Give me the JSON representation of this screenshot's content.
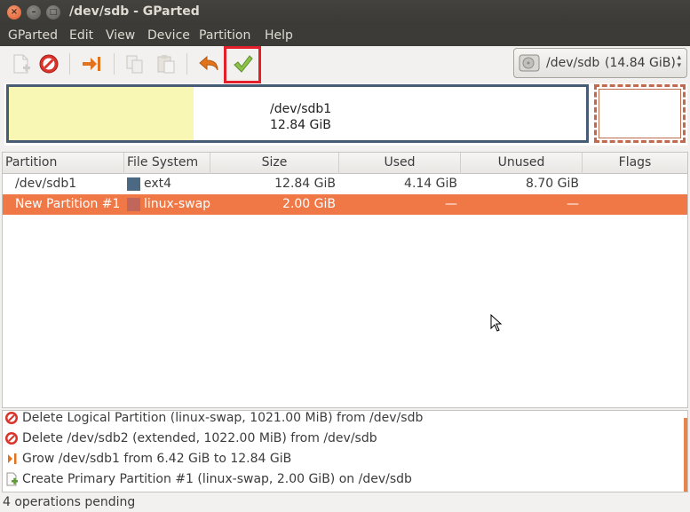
{
  "window": {
    "title": "/dev/sdb - GParted"
  },
  "menubar": {
    "items": [
      "GParted",
      "Edit",
      "View",
      "Device",
      "Partition",
      "Help"
    ]
  },
  "toolbar": {
    "buttons": [
      {
        "icon": "new-partition-icon",
        "enabled": false
      },
      {
        "icon": "delete-icon",
        "enabled": true
      },
      {
        "icon": "resize-move-icon",
        "enabled": true
      },
      {
        "icon": "copy-icon",
        "enabled": false
      },
      {
        "icon": "paste-icon",
        "enabled": false
      },
      {
        "icon": "undo-icon",
        "enabled": true
      },
      {
        "icon": "apply-icon",
        "enabled": true
      }
    ]
  },
  "device_selector": {
    "device": "/dev/sdb",
    "size": "(14.84 GiB)"
  },
  "disk_map": {
    "partition_name": "/dev/sdb1",
    "partition_size": "12.84 GiB",
    "used_fraction": 0.32
  },
  "table": {
    "headers": [
      "Partition",
      "File System",
      "Size",
      "Used",
      "Unused",
      "Flags"
    ],
    "rows": [
      {
        "partition": "/dev/sdb1",
        "fs": "ext4",
        "fs_color": "#4b6983",
        "size": "12.84 GiB",
        "used": "4.14 GiB",
        "unused": "8.70 GiB",
        "flags": "",
        "selected": false
      },
      {
        "partition": "New Partition #1",
        "fs": "linux-swap",
        "fs_color": "#c1665a",
        "size": "2.00 GiB",
        "used": "—",
        "unused": "—",
        "flags": "",
        "selected": true
      }
    ]
  },
  "operations": [
    {
      "icon": "delete-icon",
      "text": "Delete Logical Partition (linux-swap, 1021.00 MiB) from /dev/sdb"
    },
    {
      "icon": "delete-icon",
      "text": "Delete /dev/sdb2 (extended, 1022.00 MiB) from /dev/sdb"
    },
    {
      "icon": "resize-move-icon",
      "text": "Grow /dev/sdb1 from 6.42 GiB to 12.84 GiB"
    },
    {
      "icon": "new-partition-icon",
      "text": "Create Primary Partition #1 (linux-swap, 2.00 GiB) on /dev/sdb"
    }
  ],
  "status": {
    "text": "4 operations pending"
  },
  "colors": {
    "accent": "#f07746",
    "ext4": "#4b6983",
    "linux_swap": "#c1665a",
    "highlight_box": "#e3202a"
  }
}
